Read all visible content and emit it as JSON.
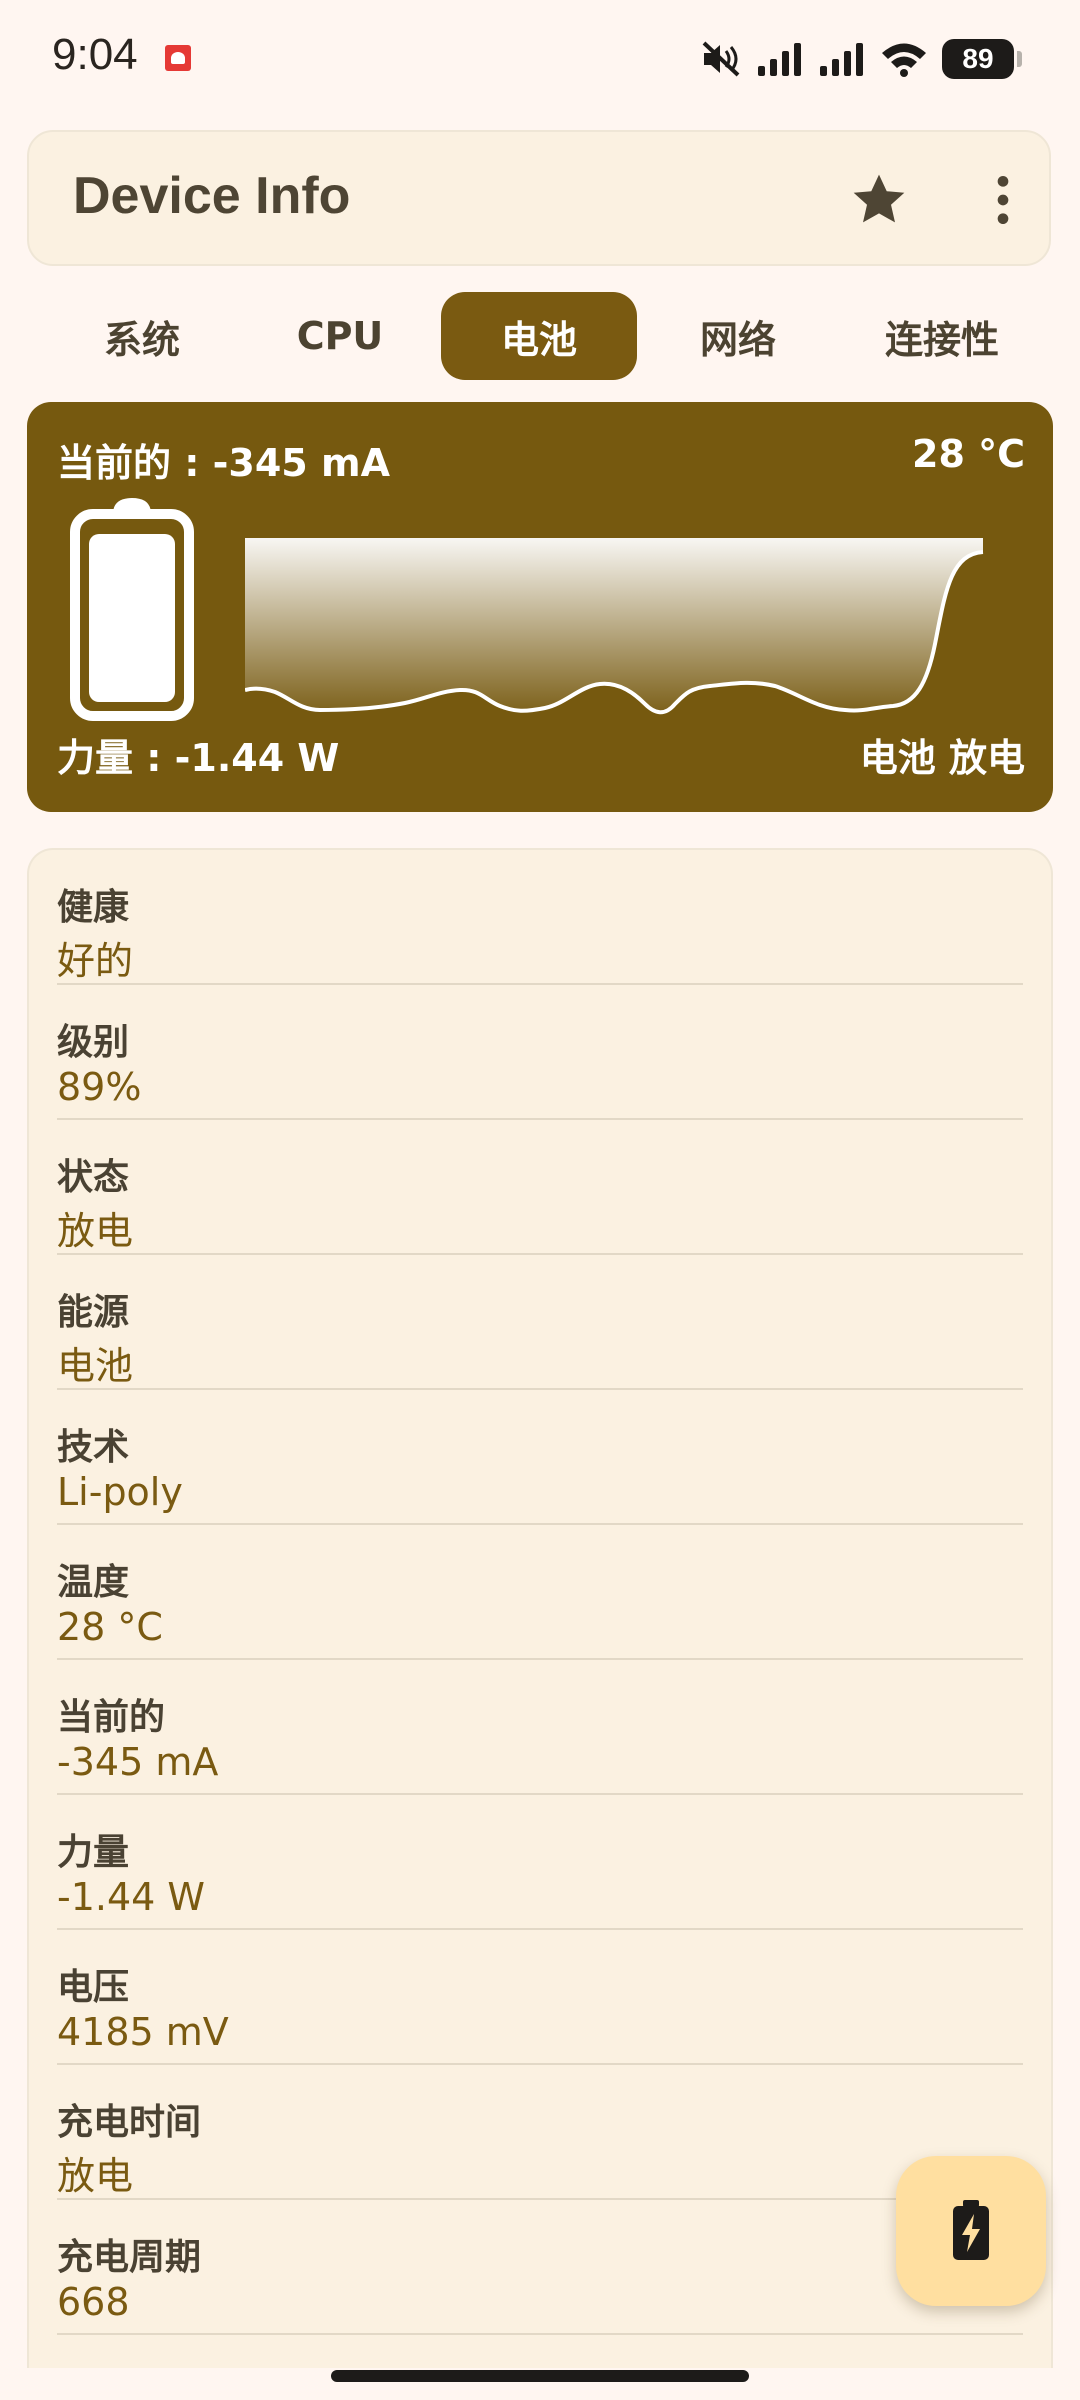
{
  "status_bar": {
    "time": "9:04",
    "battery": "89",
    "icons": [
      "notification-app-icon",
      "mute-icon",
      "signal-icon",
      "signal-icon",
      "wifi-icon",
      "battery-icon"
    ]
  },
  "app_bar": {
    "title": "Device Info",
    "icons": [
      "star-icon",
      "more-vert-icon"
    ]
  },
  "tabs": [
    {
      "label": "系统"
    },
    {
      "label": "CPU"
    },
    {
      "label": "电池"
    },
    {
      "label": "网络"
    },
    {
      "label": "连接性"
    }
  ],
  "active_tab": 2,
  "hero": {
    "current": "当前的 : -345 mA",
    "temperature": "28 °C",
    "power": "力量 : -1.44 W",
    "source": "电池 放电"
  },
  "info": [
    {
      "label": "健康",
      "value": "好的"
    },
    {
      "label": "级别",
      "value": "89%"
    },
    {
      "label": "状态",
      "value": "放电"
    },
    {
      "label": "能源",
      "value": "电池"
    },
    {
      "label": "技术",
      "value": "Li-poly"
    },
    {
      "label": "温度",
      "value": "28 °C"
    },
    {
      "label": "当前的",
      "value": "-345 mA"
    },
    {
      "label": "力量",
      "value": "-1.44 W"
    },
    {
      "label": "电压",
      "value": "4185 mV"
    },
    {
      "label": "充电时间",
      "value": "放电"
    },
    {
      "label": "充电周期",
      "value": "668"
    }
  ],
  "fab": {
    "icon": "battery-charging-icon"
  },
  "colors": {
    "background": "#fff6f1",
    "accent": "#7a5a11",
    "card": "#fbf1e1",
    "fab": "#ffdfa0"
  }
}
